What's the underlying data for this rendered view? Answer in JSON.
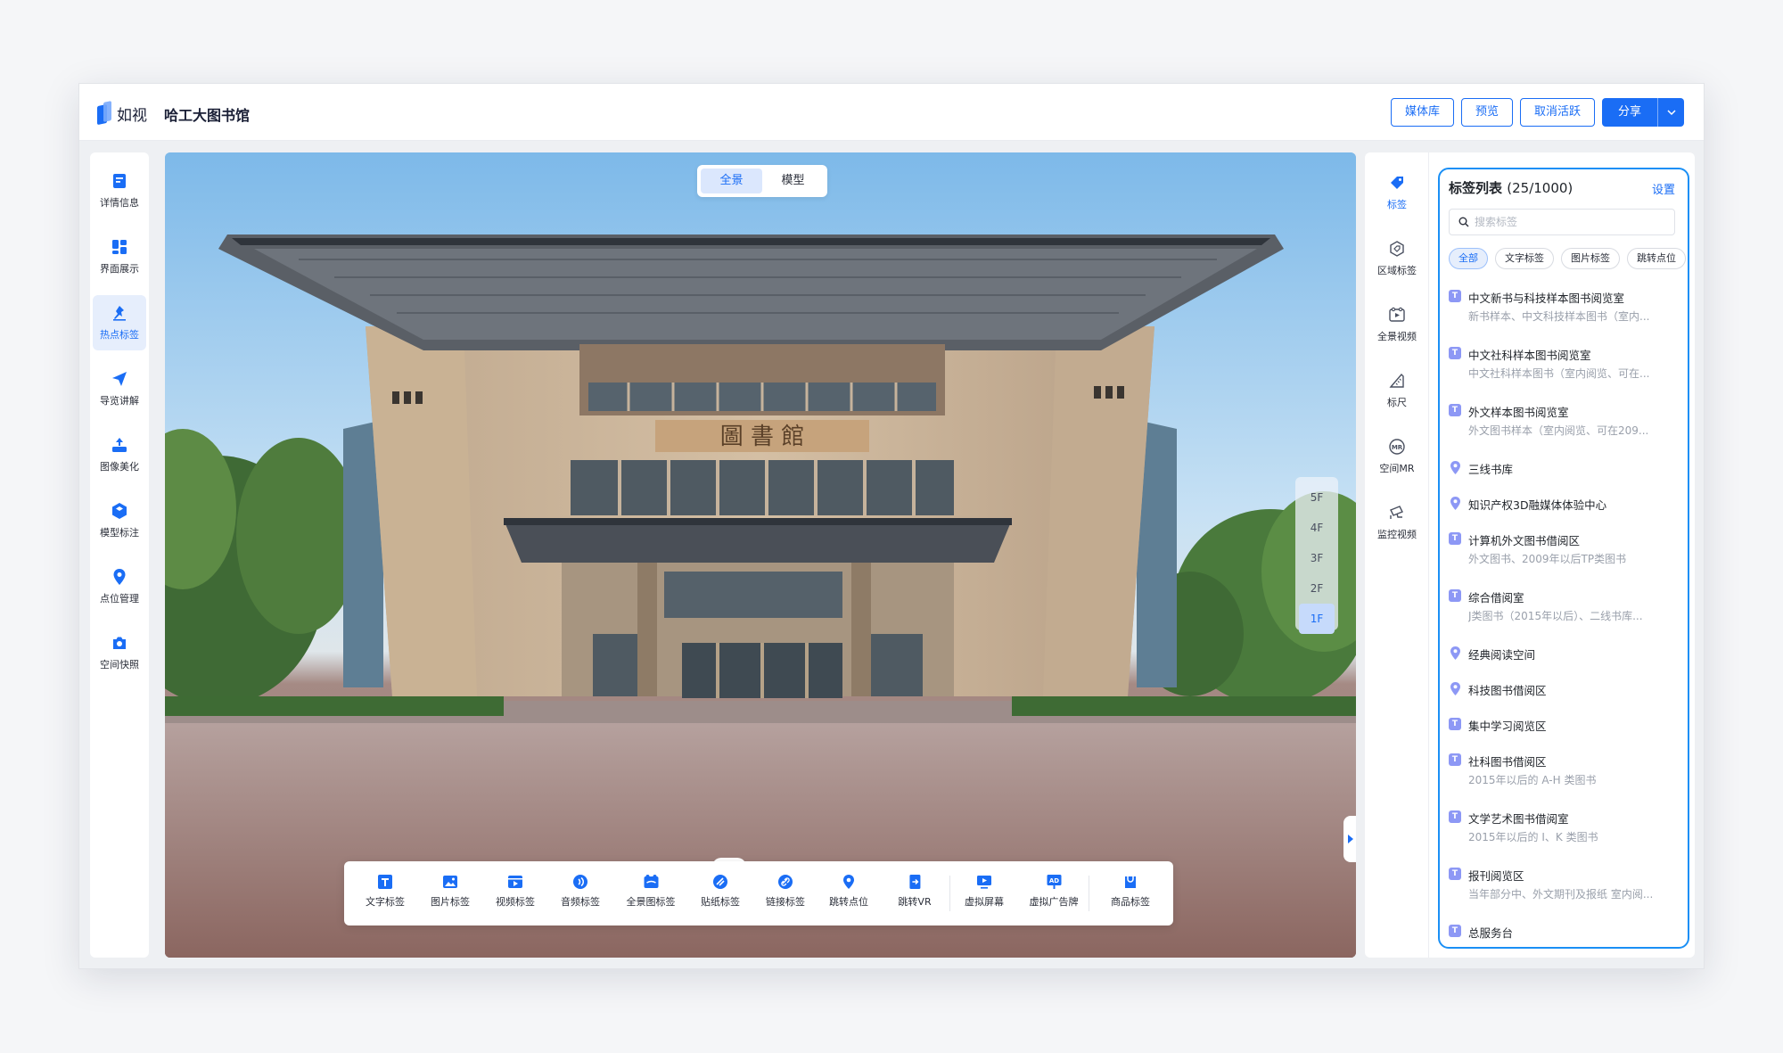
{
  "app": {
    "logo_text": "如视",
    "doc_title": "哈工大图书馆"
  },
  "header": {
    "media_library": "媒体库",
    "preview": "预览",
    "deactivate": "取消活跃",
    "share": "分享"
  },
  "left_nav": [
    {
      "label": "详情信息",
      "icon": "details-icon",
      "active": false
    },
    {
      "label": "界面展示",
      "icon": "layout-icon",
      "active": false
    },
    {
      "label": "热点标签",
      "icon": "hotspot-pin-icon",
      "active": true
    },
    {
      "label": "导览讲解",
      "icon": "send-icon",
      "active": false
    },
    {
      "label": "图像美化",
      "icon": "image-beautify-icon",
      "active": false
    },
    {
      "label": "模型标注",
      "icon": "model-cube-icon",
      "active": false
    },
    {
      "label": "点位管理",
      "icon": "location-pin-icon",
      "active": false
    },
    {
      "label": "空间快照",
      "icon": "camera-icon",
      "active": false
    }
  ],
  "viewer": {
    "view_toggle": {
      "panorama": "全景",
      "model": "模型",
      "selected": "全景"
    },
    "floors": [
      "5F",
      "4F",
      "3F",
      "2F",
      "1F"
    ],
    "active_floor": "1F",
    "building_sign": "圖 書 館"
  },
  "toolbar": [
    {
      "label": "文字标签",
      "icon": "text-tag-icon"
    },
    {
      "label": "图片标签",
      "icon": "image-tag-icon"
    },
    {
      "label": "视频标签",
      "icon": "video-tag-icon"
    },
    {
      "label": "音频标签",
      "icon": "audio-tag-icon"
    },
    {
      "label": "全景图标签",
      "icon": "panorama-tag-icon"
    },
    {
      "label": "贴纸标签",
      "icon": "sticker-tag-icon"
    },
    {
      "label": "链接标签",
      "icon": "link-tag-icon"
    },
    {
      "label": "跳转点位",
      "icon": "jump-point-icon"
    },
    {
      "label": "跳转VR",
      "icon": "jump-vr-icon"
    },
    {
      "label": "虚拟屏幕",
      "icon": "virtual-screen-icon"
    },
    {
      "label": "虚拟广告牌",
      "icon": "virtual-billboard-icon"
    },
    {
      "label": "商品标签",
      "icon": "product-tag-icon"
    }
  ],
  "right_nav": [
    {
      "label": "标签",
      "icon": "tag-icon",
      "active": true
    },
    {
      "label": "区域标签",
      "icon": "area-tag-icon",
      "active": false
    },
    {
      "label": "全景视频",
      "icon": "panorama-video-icon",
      "active": false
    },
    {
      "label": "标尺",
      "icon": "ruler-icon",
      "active": false
    },
    {
      "label": "空间MR",
      "icon": "mr-icon",
      "active": false
    },
    {
      "label": "监控视频",
      "icon": "surveillance-camera-icon",
      "active": false
    }
  ],
  "tag_panel": {
    "title": "标签列表",
    "count": "(25/1000)",
    "settings": "设置",
    "search_placeholder": "搜索标签",
    "filters": [
      "全部",
      "文字标签",
      "图片标签",
      "跳转点位"
    ],
    "active_filter": "全部",
    "items": [
      {
        "type": "text",
        "title": "中文新书与科技样本图书阅览室",
        "subtitle": "新书样本、中文科技样本图书（室内..."
      },
      {
        "type": "text",
        "title": "中文社科样本图书阅览室",
        "subtitle": "中文社科样本图书（室内阅览、可在..."
      },
      {
        "type": "text",
        "title": "外文样本图书阅览室",
        "subtitle": "外文图书样本（室内阅览、可在209..."
      },
      {
        "type": "point",
        "title": "三线书库",
        "subtitle": ""
      },
      {
        "type": "point",
        "title": "知识产权3D融媒体体验中心",
        "subtitle": ""
      },
      {
        "type": "text",
        "title": "计算机外文图书借阅区",
        "subtitle": "外文图书、2009年以后TP类图书"
      },
      {
        "type": "text",
        "title": "综合借阅室",
        "subtitle": "J类图书（2015年以后）、二线书库..."
      },
      {
        "type": "point",
        "title": "经典阅读空间",
        "subtitle": ""
      },
      {
        "type": "point",
        "title": "科技图书借阅区",
        "subtitle": ""
      },
      {
        "type": "text",
        "title": "集中学习阅览区",
        "subtitle": ""
      },
      {
        "type": "text",
        "title": "社科图书借阅区",
        "subtitle": "2015年以后的 A-H 类图书"
      },
      {
        "type": "text",
        "title": "文学艺术图书借阅室",
        "subtitle": "2015年以后的 I、K 类图书"
      },
      {
        "type": "text",
        "title": "报刊阅览区",
        "subtitle": "当年部分中、外文期刊及报纸 室内阅..."
      },
      {
        "type": "text",
        "title": "总服务台",
        "subtitle": ""
      }
    ]
  },
  "colors": {
    "accent": "#1a6df5",
    "panel_border": "#1a8ff5",
    "tag_text_icon": "#8d98f5"
  }
}
